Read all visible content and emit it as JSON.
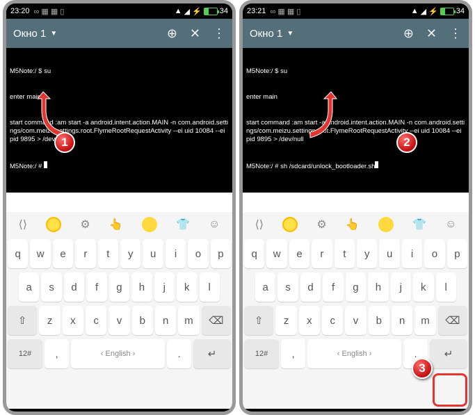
{
  "screens": {
    "left": {
      "status": {
        "time": "23:20",
        "battery": "34"
      },
      "appbar": {
        "title": "Окно 1"
      },
      "terminal": [
        "M5Note:/ $ su",
        "enter main",
        "start command :am start -a android.intent.action.MAIN -n com.android.settings/com.meizu.settings.root.FlymeRootRequestActivity --ei uid 10084 --ei pid 9895 > /dev/null",
        "M5Note:/ # "
      ]
    },
    "right": {
      "status": {
        "time": "23:21",
        "battery": "34"
      },
      "appbar": {
        "title": "Окно 1"
      },
      "terminal": [
        "M5Note:/ $ su",
        "enter main",
        "start command :am start -a android.intent.action.MAIN -n com.android.settings/com.meizu.settings.root.FlymeRootRequestActivity --ei uid 10084 --ei pid 9895 > /dev/null",
        "M5Note:/ # sh /sdcard/unlock_bootloader.sh"
      ]
    }
  },
  "keyboard": {
    "row1": [
      "q",
      "w",
      "e",
      "r",
      "t",
      "y",
      "u",
      "i",
      "o",
      "p"
    ],
    "row2": [
      "a",
      "s",
      "d",
      "f",
      "g",
      "h",
      "j",
      "k",
      "l"
    ],
    "row3_mid": [
      "z",
      "x",
      "c",
      "v",
      "b",
      "n",
      "m"
    ],
    "sym": "12#",
    "comma": ",",
    "lang": "English",
    "period": "."
  },
  "badges": {
    "b1": "1",
    "b2": "2",
    "b3": "3"
  }
}
